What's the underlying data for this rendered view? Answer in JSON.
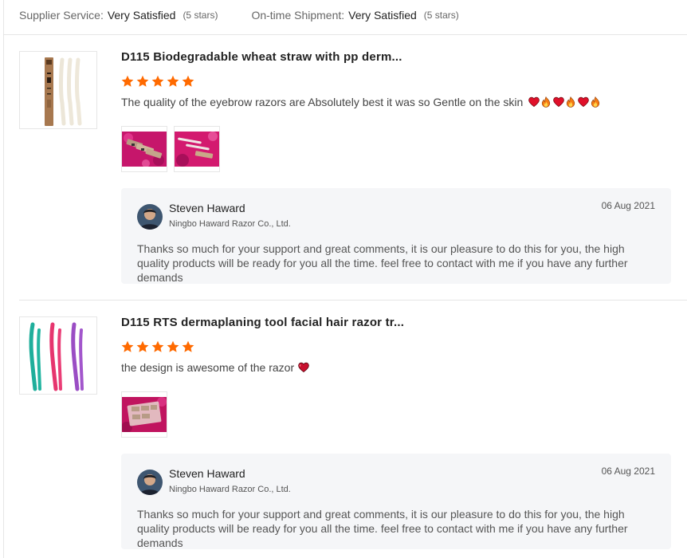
{
  "summary": {
    "supplier_service_label": "Supplier Service:",
    "supplier_service_value": "Very Satisfied",
    "supplier_service_stars": "(5 stars)",
    "ontime_label": "On-time Shipment:",
    "ontime_value": "Very Satisfied",
    "ontime_stars": "(5 stars)"
  },
  "reviews": [
    {
      "product_title": "D115 Biodegradable wheat straw with pp derm...",
      "rating": 5,
      "comment": "The quality of the eyebrow razors are Absolutely best it was so Gentle on the skin",
      "emojis": [
        "red-heart",
        "fire",
        "red-heart",
        "fire",
        "red-heart",
        "fire"
      ],
      "reply": {
        "name": "Steven Haward",
        "company": "Ningbo Haward Razor Co., Ltd.",
        "date": "06 Aug 2021",
        "text": "Thanks so much for your support and great comments, it is our pleasure to do this for you, the high quality products will be ready for you all the time. feel free to contact with me if you have any further demands"
      }
    },
    {
      "product_title": "D115 RTS dermaplaning tool facial hair razor tr...",
      "rating": 5,
      "comment": "the design is awesome of the razor",
      "emojis": [
        "heart-icon"
      ],
      "reply": {
        "name": "Steven Haward",
        "company": "Ningbo Haward Razor Co., Ltd.",
        "date": "06 Aug 2021",
        "text": "Thanks so much for your support and great comments, it is our pleasure to do this for you, the high quality products will be ready for you all the time. feel free to contact with me if you have any further demands"
      }
    }
  ],
  "colors": {
    "star": "#ff6a00",
    "reply_bg": "#f5f6f8",
    "title": "#222222"
  }
}
